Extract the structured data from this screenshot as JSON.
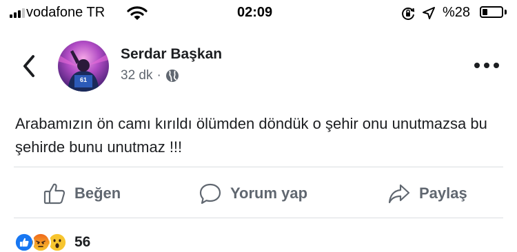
{
  "status_bar": {
    "carrier": "vodafone TR",
    "time": "02:09",
    "battery_text": "%28",
    "battery_level": 0.28,
    "signal_bars_active": 3,
    "signal_bars_total": 4
  },
  "post": {
    "author": "Serdar Başkan",
    "time_ago": "32 dk",
    "separator": "·",
    "privacy_icon": "globe-icon",
    "text": "Arabamızın ön camı kırıldı ölümden döndük o şehir onu unutmazsa bu şehirde bunu unutmaz !!!",
    "actions": {
      "like_label": "Beğen",
      "comment_label": "Yorum yap",
      "share_label": "Paylaş"
    },
    "reactions": {
      "types": [
        "like",
        "angry",
        "wow"
      ],
      "count": "56"
    }
  },
  "colors": {
    "text_primary": "#1c1e21",
    "text_secondary": "#606770",
    "divider": "#dadde1",
    "like_blue": "#1877f2",
    "angry_orange": "#f0691c",
    "wow_yellow": "#f7c52f"
  }
}
